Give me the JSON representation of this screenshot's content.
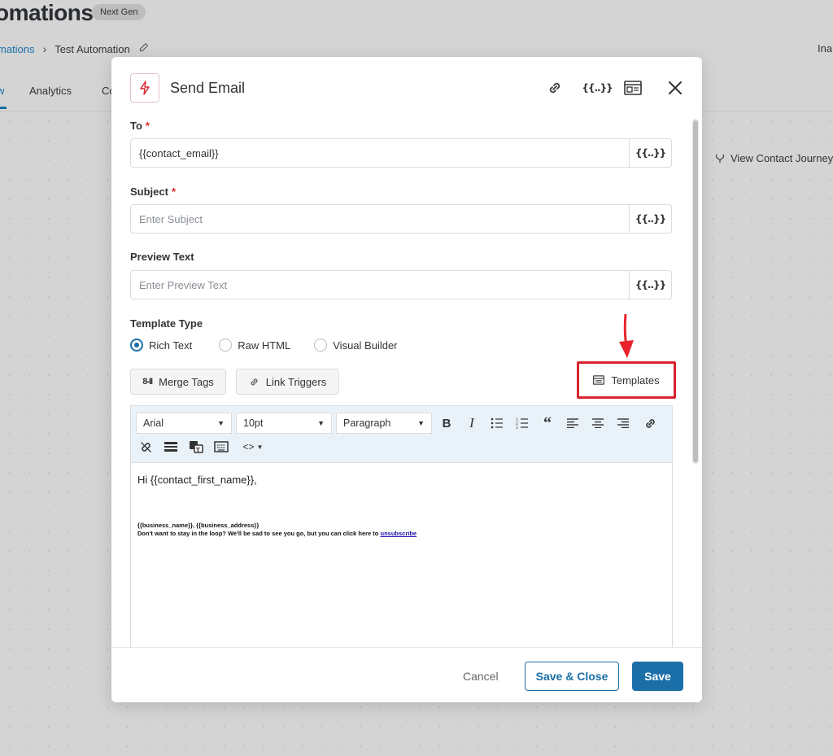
{
  "page": {
    "title": "omations",
    "badge": "Next Gen",
    "breadcrumb": {
      "parent": "mations",
      "current": "Test Automation"
    },
    "status_right": "Ina",
    "tabs": [
      {
        "label": "w"
      },
      {
        "label": "Analytics"
      },
      {
        "label": "Co"
      }
    ],
    "view_journey": "View Contact Journey"
  },
  "modal": {
    "title": "Send Email",
    "fields": {
      "to": {
        "label": "To",
        "value": "{{contact_email}}",
        "placeholder": ""
      },
      "subject": {
        "label": "Subject",
        "value": "",
        "placeholder": "Enter Subject"
      },
      "preview": {
        "label": "Preview Text",
        "value": "",
        "placeholder": "Enter Preview Text"
      }
    },
    "merge_tag_glyph": "{{..}}",
    "template_type": {
      "label": "Template Type",
      "options": [
        "Rich Text",
        "Raw HTML",
        "Visual Builder"
      ],
      "selected": "Rich Text"
    },
    "buttons": {
      "merge_tags": "Merge Tags",
      "link_triggers": "Link Triggers",
      "templates": "Templates"
    },
    "toolbar": {
      "font": "Arial",
      "size": "10pt",
      "block": "Paragraph"
    },
    "editor": {
      "greeting": "Hi {{contact_first_name}},",
      "footer_line1": "{{business_name}}, {{business_address}}",
      "footer_line2": "Don't want to stay in the loop? We'll be sad to see you go, but you can click here to",
      "unsubscribe": "unsubscribe"
    },
    "footer": {
      "cancel": "Cancel",
      "save_close": "Save & Close",
      "save": "Save"
    }
  },
  "colors": {
    "accent": "#1b6fa8",
    "highlight": "#d9232e",
    "required": "#e02424"
  }
}
